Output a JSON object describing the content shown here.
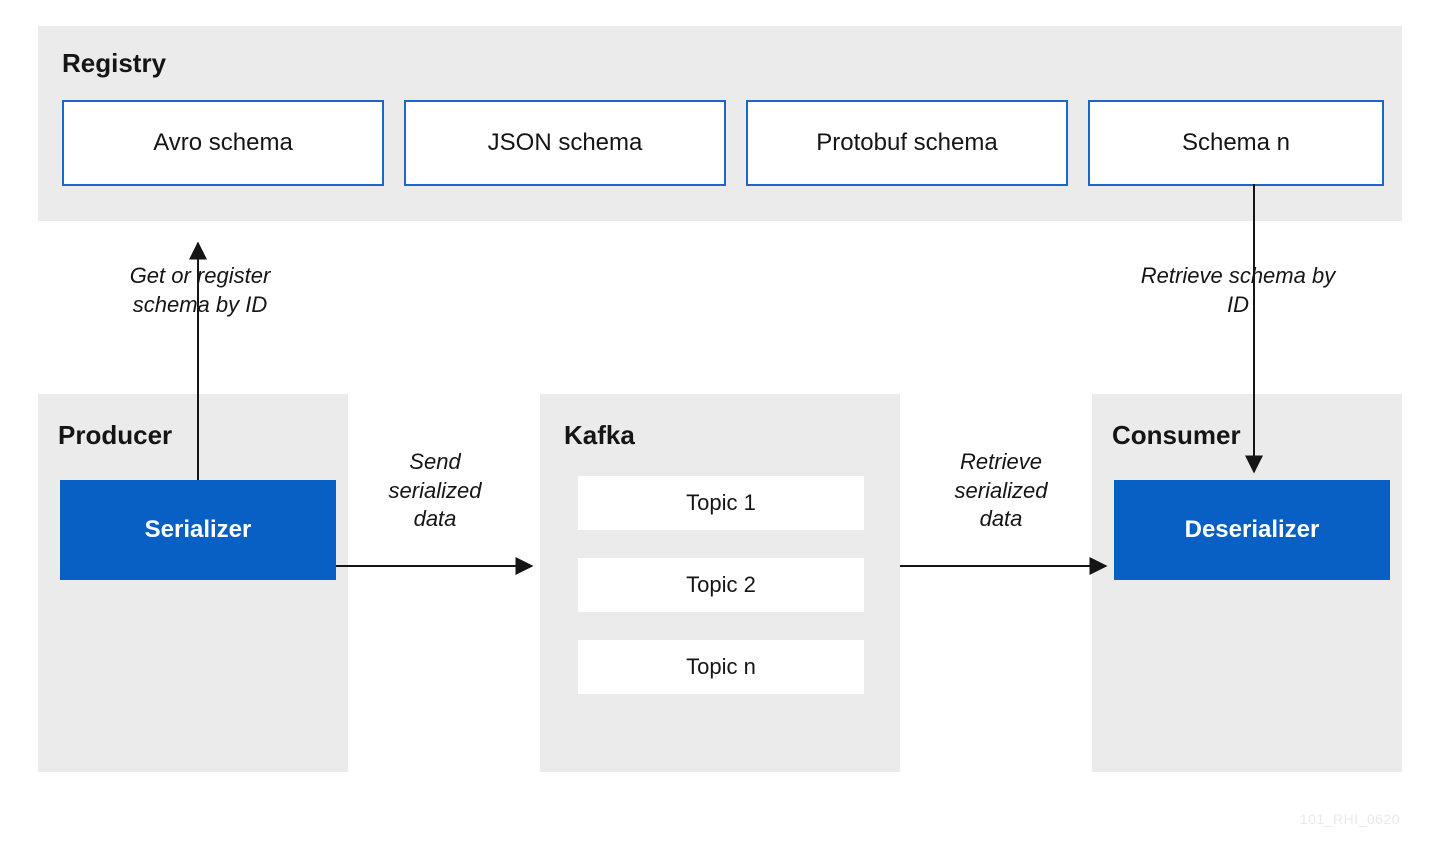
{
  "registry": {
    "title": "Registry",
    "schemas": [
      {
        "label": "Avro schema"
      },
      {
        "label": "JSON schema"
      },
      {
        "label": "Protobuf schema"
      },
      {
        "label": "Schema n"
      }
    ]
  },
  "producer": {
    "title": "Producer",
    "node": "Serializer",
    "arrow_label": "Get or register schema by ID"
  },
  "kafka": {
    "title": "Kafka",
    "topics": [
      "Topic 1",
      "Topic 2",
      "Topic n"
    ]
  },
  "consumer": {
    "title": "Consumer",
    "node": "Deserializer",
    "arrow_label": "Retrieve schema by ID"
  },
  "flows": {
    "send": "Send serialized data",
    "retrieve": "Retrieve serialized data"
  },
  "footer_code": "101_RHI_0620",
  "colors": {
    "gray_panel": "#ebebeb",
    "blue_outline": "#1b66c9",
    "blue_fill": "#0860c4"
  }
}
